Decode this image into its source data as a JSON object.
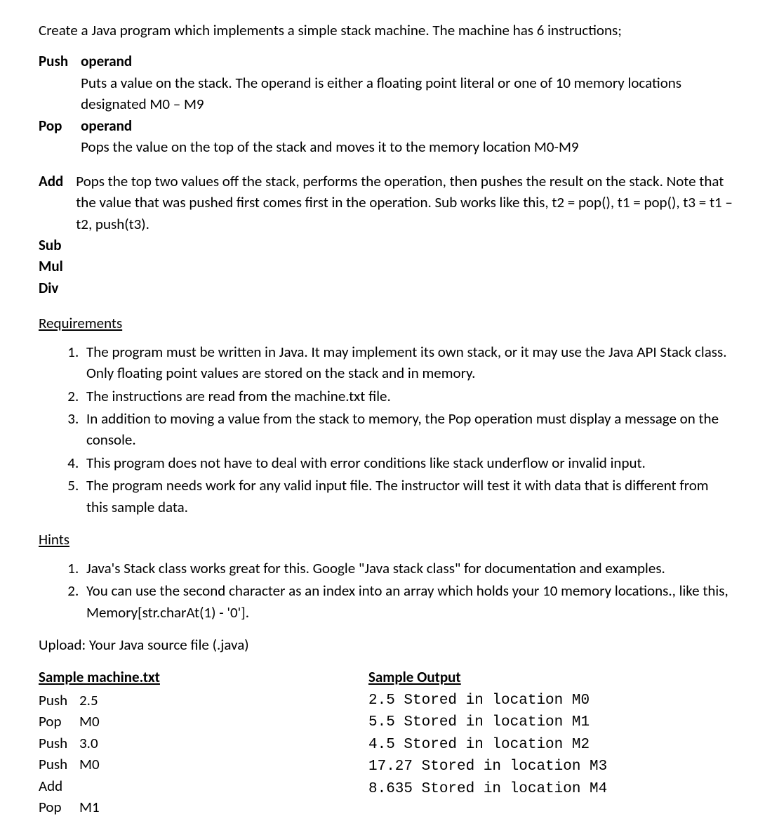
{
  "intro": "Create a Java program which implements a simple stack machine. The machine has 6 instructions;",
  "instructions": {
    "push": {
      "name": "Push",
      "operand_label": "operand",
      "desc": "Puts a value on the stack. The operand is either a floating point literal or one of 10 memory locations designated M0 – M9"
    },
    "pop": {
      "name": "Pop",
      "operand_label": "operand",
      "desc": "Pops the value on the top of the stack and moves it to the memory location M0-M9"
    },
    "arith": {
      "names": [
        "Add",
        "Sub",
        "Mul",
        "Div"
      ],
      "desc": "Pops the top two values off the stack, performs the operation, then pushes the result on the stack. Note that the value that was pushed first comes first in the operation. Sub works like this, t2 = pop(), t1 = pop(), t3 = t1 – t2, push(t3)."
    }
  },
  "requirements": {
    "header": "Requirements",
    "items": [
      "The program must be written in Java. It may implement its own stack, or it may use the Java API Stack class. Only floating point values are stored on the stack and in memory.",
      "The instructions are read from the machine.txt file.",
      "In addition to moving a value from the stack to memory, the Pop operation must display a message on the console.",
      "This program does not have to deal with error conditions like stack underflow or invalid input.",
      "The program needs work for any valid input file. The instructor will test it with data that is different from this sample data."
    ]
  },
  "hints": {
    "header": "Hints",
    "items": [
      "Java's Stack class works great for this. Google \"Java stack class\" for documentation and examples.",
      "You can use the second character as an index into an array which holds your 10 memory locations., like this, Memory[str.charAt(1) - '0']."
    ]
  },
  "upload": "Upload: Your Java source file (.java)",
  "sample_input": {
    "header": "Sample machine.txt",
    "lines": [
      {
        "op": "Push",
        "arg": "2.5"
      },
      {
        "op": "Pop",
        "arg": "M0"
      },
      {
        "op": "Push",
        "arg": "3.0"
      },
      {
        "op": "Push",
        "arg": "M0"
      },
      {
        "op": "Add",
        "arg": ""
      },
      {
        "op": "Pop",
        "arg": "M1"
      }
    ]
  },
  "sample_output": {
    "header": "Sample Output",
    "lines": [
      "2.5 Stored in location M0",
      "5.5 Stored in location M1",
      "4.5 Stored in location M2",
      "17.27 Stored in location M3",
      "8.635 Stored in location M4"
    ]
  }
}
